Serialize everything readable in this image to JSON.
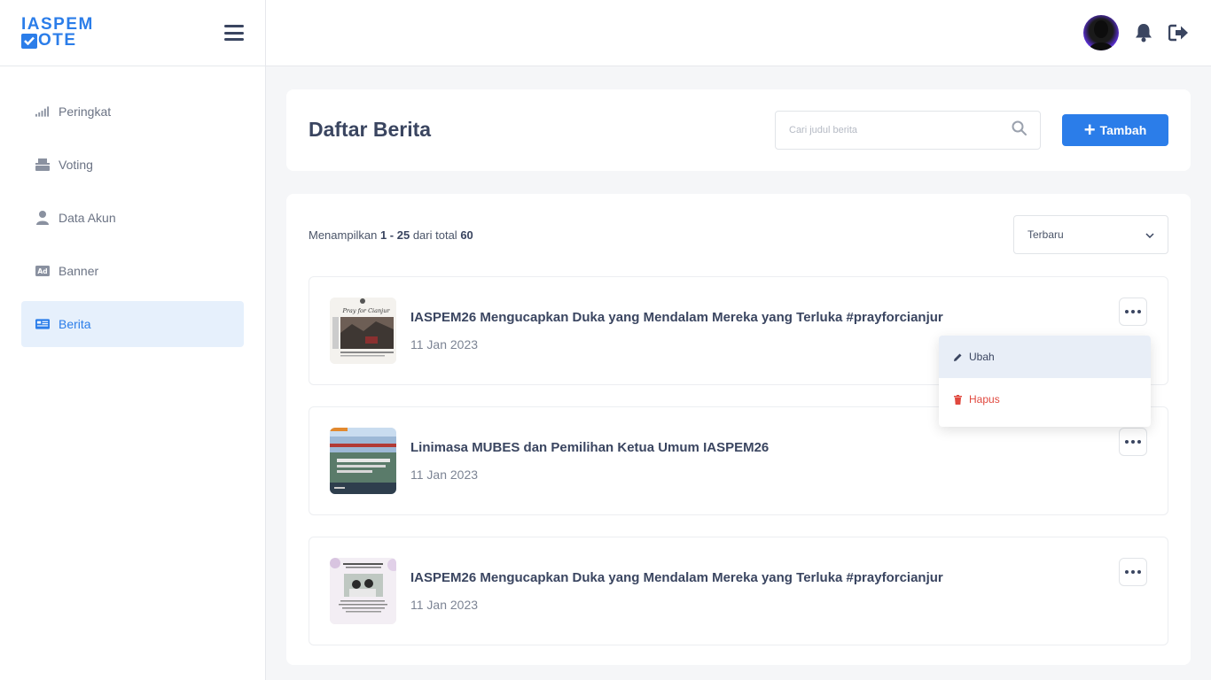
{
  "brand": {
    "line1": "IASPEM",
    "line2": "OTE",
    "color": "#2b7de9"
  },
  "sidebar": {
    "items": [
      {
        "label": "Peringkat",
        "icon": "signal-bars-icon",
        "active": false
      },
      {
        "label": "Voting",
        "icon": "ballot-box-icon",
        "active": false
      },
      {
        "label": "Data Akun",
        "icon": "user-icon",
        "active": false
      },
      {
        "label": "Banner",
        "icon": "ad-icon",
        "active": false
      },
      {
        "label": "Berita",
        "icon": "newspaper-icon",
        "active": true
      }
    ]
  },
  "topbar": {
    "avatar": "avatar",
    "notification_icon": "bell-icon",
    "logout_icon": "logout-icon"
  },
  "header": {
    "title": "Daftar Berita",
    "search_placeholder": "Cari judul berita",
    "add_label": "Tambah"
  },
  "list": {
    "showing_prefix": "Menampilkan",
    "range": "1 - 25",
    "total_prefix": "dari total",
    "total": "60",
    "sort_value": "Terbaru",
    "items": [
      {
        "title": "IASPEM26 Mengucapkan Duka yang Mendalam Mereka yang Terluka #prayforcianjur",
        "date": "11 Jan 2023",
        "thumb_text": "Pray for Cianjur"
      },
      {
        "title": "Linimasa MUBES dan Pemilihan Ketua Umum IASPEM26",
        "date": "11 Jan 2023"
      },
      {
        "title": "IASPEM26 Mengucapkan Duka yang Mendalam Mereka yang Terluka #prayforcianjur",
        "date": "11 Jan 2023"
      }
    ]
  },
  "menu": {
    "edit_label": "Ubah",
    "delete_label": "Hapus"
  },
  "colors": {
    "primary": "#2b7de9",
    "danger": "#e0483e",
    "text": "#3a4560"
  }
}
